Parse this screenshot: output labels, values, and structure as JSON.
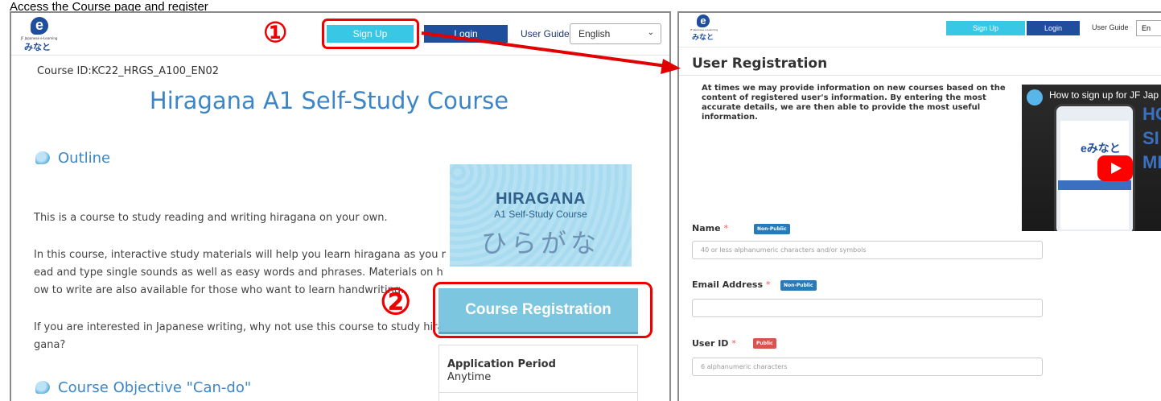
{
  "caption": "Access the Course page and register",
  "left": {
    "logo": {
      "letter": "e",
      "tiny": "JF Japanese e-Learning",
      "name": "みなと"
    },
    "markers": {
      "one": "①",
      "two": "②"
    },
    "header": {
      "signup": "Sign Up",
      "login": "Login",
      "guide": "User Guide",
      "language": "English"
    },
    "course_id": "Course ID:KC22_HRGS_A100_EN02",
    "title": "Hiragana A1 Self-Study Course",
    "outline": {
      "heading": "Outline",
      "p1": "This is a course to study reading and writing hiragana on your own.",
      "p2": "In this course, interactive study materials will help you learn hiragana as you read and type single sounds as well as easy words and phrases. Materials on how to write are also available for those who want to learn handwriting.",
      "p3": "If you are interested in Japanese writing, why not use this course to study hiragana?"
    },
    "objective_heading": "Course Objective \"Can-do\"",
    "banner": {
      "title": "HIRAGANA",
      "subtitle": "A1 Self-Study Course",
      "kana": "ひらがな"
    },
    "register_button": "Course Registration",
    "application": {
      "label": "Application Period",
      "value": "Anytime"
    }
  },
  "right": {
    "logo": {
      "letter": "e",
      "tiny": "JF Japanese e-Learning",
      "name": "みなと"
    },
    "header": {
      "signup": "Sign Up",
      "login": "Login",
      "guide": "User Guide",
      "language": "En"
    },
    "title": "User Registration",
    "info": "At times we may provide information on new courses based on the content of registered user's information. By entering the most accurate details, we are then able to provide the most useful information.",
    "video": {
      "title": "How to sign up for JF Jap",
      "big": "HO SI MI",
      "phone_logo": "eみなと"
    },
    "fields": [
      {
        "label": "Name",
        "required": "*",
        "badge": "Non-Public",
        "placeholder": "40 or less alphanumeric characters and/or symbols"
      },
      {
        "label": "Email Address",
        "required": "*",
        "badge": "Non-Public",
        "placeholder": ""
      },
      {
        "label": "User ID",
        "required": "*",
        "badge": "Public",
        "placeholder": "6 alphanumeric characters"
      }
    ]
  },
  "colors": {
    "accent_cyan": "#38c7e4",
    "brand_blue": "#1f4e9c",
    "annotation_red": "#e00000",
    "heading_blue": "#3c86c8"
  }
}
